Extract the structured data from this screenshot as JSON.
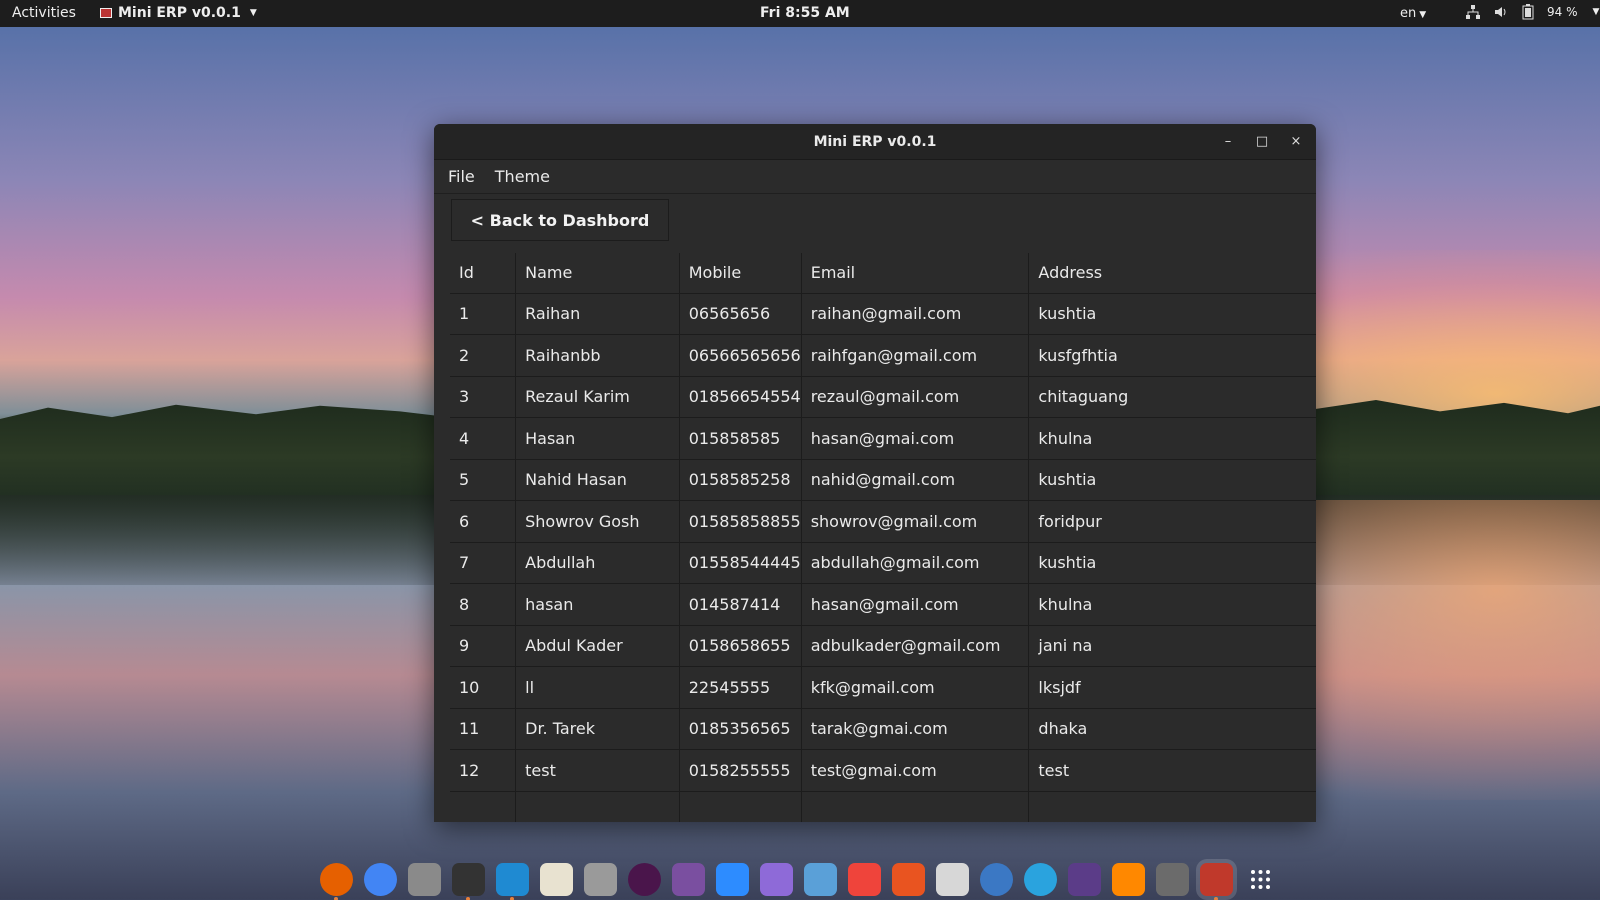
{
  "topbar": {
    "activities": "Activities",
    "app_menu": "Mini ERP v0.0.1",
    "clock": "Fri  8:55 AM",
    "lang": "en",
    "battery": "94 %",
    "icons": [
      "network-icon",
      "volume-icon",
      "battery-icon"
    ]
  },
  "window": {
    "title": "Mini ERP v0.0.1",
    "controls": {
      "minimize": "–",
      "maximize": "□",
      "close": "×"
    }
  },
  "menu": {
    "file": "File",
    "theme": "Theme"
  },
  "back_button": "< Back to Dashbord",
  "table": {
    "headers": [
      "Id",
      "Name",
      "Mobile",
      "Email",
      "Address"
    ],
    "rows": [
      [
        "1",
        "Raihan",
        "06565656",
        "raihan@gmail.com",
        "kushtia"
      ],
      [
        "2",
        "Raihanbb",
        "06566565656",
        "raihfgan@gmail.com",
        "kusfgfhtia"
      ],
      [
        "3",
        "Rezaul Karim",
        "01856654554",
        "rezaul@gmail.com",
        "chitaguang"
      ],
      [
        "4",
        "Hasan",
        "015858585",
        "hasan@gmai.com",
        "khulna"
      ],
      [
        "5",
        "Nahid Hasan",
        "0158585258",
        "nahid@gmail.com",
        "kushtia"
      ],
      [
        "6",
        "Showrov Gosh",
        "01585858855",
        "showrov@gmail.com",
        "foridpur"
      ],
      [
        "7",
        "Abdullah",
        "01558544445",
        "abdullah@gmail.com",
        "kushtia"
      ],
      [
        "8",
        "hasan",
        "014587414",
        "hasan@gmail.com",
        "khulna"
      ],
      [
        "9",
        "Abdul Kader",
        "0158658655",
        "adbulkader@gmail.com",
        "jani na"
      ],
      [
        "10",
        "ll",
        "22545555",
        "kfk@gmail.com",
        "lksjdf"
      ],
      [
        "11",
        "Dr. Tarek",
        "0185356565",
        "tarak@gmai.com",
        "dhaka"
      ],
      [
        "12",
        "test",
        "0158255555",
        "test@gmai.com",
        "test"
      ]
    ]
  },
  "dock": [
    {
      "name": "firefox-icon",
      "color": "#e66000",
      "running": true
    },
    {
      "name": "chrome-icon",
      "color": "#4285f4",
      "running": false
    },
    {
      "name": "files-icon",
      "color": "#8a8a8a",
      "running": false
    },
    {
      "name": "terminal-icon",
      "color": "#333333",
      "running": true
    },
    {
      "name": "vscode-icon",
      "color": "#1f8ad2",
      "running": true
    },
    {
      "name": "text-editor-icon",
      "color": "#e8e2d0",
      "running": false
    },
    {
      "name": "camera-icon",
      "color": "#9a9a9a",
      "running": false
    },
    {
      "name": "slack-icon",
      "color": "#4a154b",
      "running": false
    },
    {
      "name": "screen-recorder-icon",
      "color": "#7a4fa0",
      "running": false
    },
    {
      "name": "zoom-icon",
      "color": "#2d8cff",
      "running": false
    },
    {
      "name": "obsidian-icon",
      "color": "#8e6ad8",
      "running": false
    },
    {
      "name": "document-viewer-icon",
      "color": "#5aa0d8",
      "running": false
    },
    {
      "name": "anydesk-icon",
      "color": "#ef443b",
      "running": false
    },
    {
      "name": "software-center-icon",
      "color": "#e95420",
      "running": false
    },
    {
      "name": "calculator-icon",
      "color": "#d7d7d7",
      "running": false
    },
    {
      "name": "qbittorrent-icon",
      "color": "#3b78c4",
      "running": false
    },
    {
      "name": "telegram-icon",
      "color": "#2aa3de",
      "running": false
    },
    {
      "name": "video-editor-icon",
      "color": "#5b3c88",
      "running": false
    },
    {
      "name": "vlc-icon",
      "color": "#ff8800",
      "running": false
    },
    {
      "name": "clapper-icon",
      "color": "#6b6b6b",
      "running": false
    },
    {
      "name": "mini-erp-icon",
      "color": "#c0392b",
      "running": true
    },
    {
      "name": "show-apps-icon",
      "color": "#ffffff",
      "running": false
    }
  ]
}
